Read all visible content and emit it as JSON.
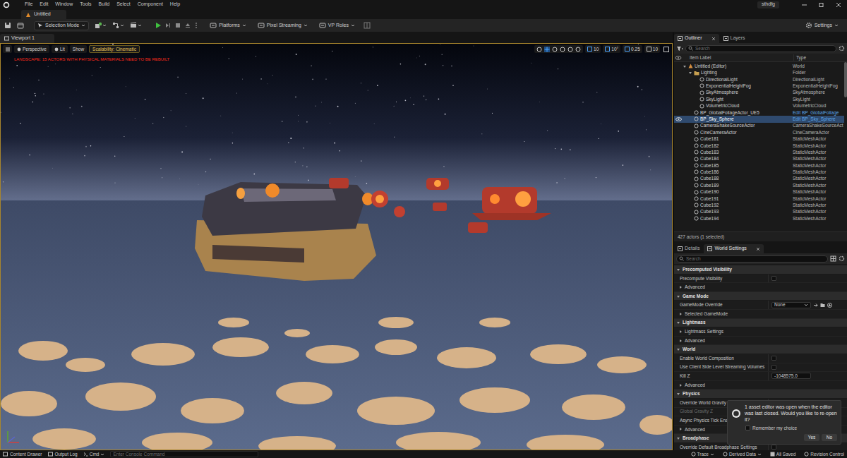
{
  "app": {
    "menu": [
      "File",
      "Edit",
      "Window",
      "Tools",
      "Build",
      "Select",
      "Component",
      "Help"
    ],
    "user": "sthdfg",
    "document_tab": "Untitled"
  },
  "toolbar": {
    "selection_mode": "Selection Mode",
    "items": [
      "Platforms",
      "Pixel Streaming",
      "VP Roles"
    ],
    "settings": "Settings"
  },
  "viewport": {
    "tab": "Viewport 1",
    "view_buttons": [
      "Perspective",
      "Lit",
      "Show",
      "Scalability: Cinematic"
    ],
    "snap_values": [
      "10",
      "10°",
      "0.25",
      "10"
    ],
    "warning": "LANDSCAPE: 15 ACTORS WITH PHYSICAL MATERIALS NEED TO BE REBUILT"
  },
  "outliner": {
    "tabs": [
      {
        "label": "Outliner",
        "selected": true
      },
      {
        "label": "Layers",
        "selected": false
      }
    ],
    "search": {
      "placeholder": "Search"
    },
    "columns": [
      "Item Label",
      "Type"
    ],
    "rows": [
      {
        "label": "Untitled (Editor)",
        "type": "World",
        "kind": "world",
        "depth": 0,
        "expanded": true,
        "selected": false,
        "link": false
      },
      {
        "label": "Lighting",
        "type": "Folder",
        "kind": "folder",
        "depth": 1,
        "expanded": true,
        "selected": false,
        "link": false
      },
      {
        "label": "DirectionalLight",
        "type": "DirectionalLight",
        "kind": "actor",
        "depth": 2,
        "selected": false,
        "link": false
      },
      {
        "label": "ExponentialHeightFog",
        "type": "ExponentialHeightFog",
        "kind": "actor",
        "depth": 2,
        "selected": false,
        "link": false
      },
      {
        "label": "SkyAtmosphere",
        "type": "SkyAtmosphere",
        "kind": "actor",
        "depth": 2,
        "selected": false,
        "link": false
      },
      {
        "label": "SkyLight",
        "type": "SkyLight",
        "kind": "actor",
        "depth": 2,
        "selected": false,
        "link": false
      },
      {
        "label": "VolumetricCloud",
        "type": "VolumetricCloud",
        "kind": "actor",
        "depth": 2,
        "selected": false,
        "link": false
      },
      {
        "label": "BP_GlobalFoliageActor_UE5",
        "type": "Edit BP_GlobalFoliage",
        "kind": "actor",
        "depth": 1,
        "selected": false,
        "link": true
      },
      {
        "label": "BP_Sky_Sphere",
        "type": "Edit BP_Sky_Sphere",
        "kind": "actor",
        "depth": 1,
        "selected": true,
        "link": true
      },
      {
        "label": "CameraShakeSourceActor",
        "type": "CameraShakeSourceAct",
        "kind": "actor",
        "depth": 1,
        "selected": false,
        "link": false
      },
      {
        "label": "CineCameraActor",
        "type": "CineCameraActor",
        "kind": "actor",
        "depth": 1,
        "selected": false,
        "link": false
      },
      {
        "label": "Cube181",
        "type": "StaticMeshActor",
        "kind": "actor",
        "depth": 1,
        "selected": false,
        "link": false
      },
      {
        "label": "Cube182",
        "type": "StaticMeshActor",
        "kind": "actor",
        "depth": 1,
        "selected": false,
        "link": false
      },
      {
        "label": "Cube183",
        "type": "StaticMeshActor",
        "kind": "actor",
        "depth": 1,
        "selected": false,
        "link": false
      },
      {
        "label": "Cube184",
        "type": "StaticMeshActor",
        "kind": "actor",
        "depth": 1,
        "selected": false,
        "link": false
      },
      {
        "label": "Cube185",
        "type": "StaticMeshActor",
        "kind": "actor",
        "depth": 1,
        "selected": false,
        "link": false
      },
      {
        "label": "Cube186",
        "type": "StaticMeshActor",
        "kind": "actor",
        "depth": 1,
        "selected": false,
        "link": false
      },
      {
        "label": "Cube188",
        "type": "StaticMeshActor",
        "kind": "actor",
        "depth": 1,
        "selected": false,
        "link": false
      },
      {
        "label": "Cube189",
        "type": "StaticMeshActor",
        "kind": "actor",
        "depth": 1,
        "selected": false,
        "link": false
      },
      {
        "label": "Cube190",
        "type": "StaticMeshActor",
        "kind": "actor",
        "depth": 1,
        "selected": false,
        "link": false
      },
      {
        "label": "Cube191",
        "type": "StaticMeshActor",
        "kind": "actor",
        "depth": 1,
        "selected": false,
        "link": false
      },
      {
        "label": "Cube192",
        "type": "StaticMeshActor",
        "kind": "actor",
        "depth": 1,
        "selected": false,
        "link": false
      },
      {
        "label": "Cube193",
        "type": "StaticMeshActor",
        "kind": "actor",
        "depth": 1,
        "selected": false,
        "link": false
      },
      {
        "label": "Cube194",
        "type": "StaticMeshActor",
        "kind": "actor",
        "depth": 1,
        "selected": false,
        "link": false
      }
    ],
    "count": "427 actors (1 selected)"
  },
  "details": {
    "tabs": [
      {
        "label": "Details",
        "selected": false
      },
      {
        "label": "World Settings",
        "selected": true
      }
    ],
    "search": {
      "placeholder": "Search"
    },
    "rows": [
      {
        "kind": "section",
        "label": "Precomputed Visibility",
        "expanded": true
      },
      {
        "kind": "checkbox",
        "label": "Precompute Visibility",
        "checked": false,
        "disabled": false
      },
      {
        "kind": "expander",
        "label": "Advanced",
        "expanded": false
      },
      {
        "kind": "section",
        "label": "Game Mode",
        "expanded": true
      },
      {
        "kind": "dropdown",
        "label": "GameMode Override",
        "value": "None",
        "disabled": false
      },
      {
        "kind": "expander",
        "label": "Selected GameMode",
        "expanded": false
      },
      {
        "kind": "section",
        "label": "Lightmass",
        "expanded": true
      },
      {
        "kind": "expander",
        "label": "Lightmass Settings",
        "expanded": false
      },
      {
        "kind": "expander",
        "label": "Advanced",
        "expanded": false
      },
      {
        "kind": "section",
        "label": "World",
        "expanded": true
      },
      {
        "kind": "checkbox",
        "label": "Enable World Composition",
        "checked": false,
        "disabled": false
      },
      {
        "kind": "checkbox",
        "label": "Use Client Side Level Streaming Volumes",
        "checked": false,
        "disabled": false
      },
      {
        "kind": "number",
        "label": "Kill Z",
        "value": "-1048575.0",
        "disabled": false
      },
      {
        "kind": "expander",
        "label": "Advanced",
        "expanded": false
      },
      {
        "kind": "section",
        "label": "Physics",
        "expanded": true
      },
      {
        "kind": "checkbox",
        "label": "Override World Gravity",
        "checked": false,
        "disabled": false
      },
      {
        "kind": "number",
        "label": "Global Gravity Z",
        "disabled": true
      },
      {
        "kind": "checkbox",
        "label": "Async Physics Tick Enab",
        "checked": false,
        "disabled": false
      },
      {
        "kind": "expander",
        "label": "Advanced",
        "expanded": false
      },
      {
        "kind": "section",
        "label": "Broadphase",
        "expanded": true
      },
      {
        "kind": "checkbox",
        "label": "Override Default Broadphase Settings",
        "checked": false,
        "disabled": false
      }
    ]
  },
  "notification": {
    "message": "1 asset editor was open when the editor was last closed. Would you like to re-open it?",
    "remember": {
      "label": "Remember my choice",
      "checked": false
    },
    "buttons": [
      "Yes",
      "No"
    ]
  },
  "status_bar": {
    "left": [
      "Content Drawer",
      "Output Log"
    ],
    "cmd": "Cmd",
    "console": {
      "placeholder": "Enter Console Command"
    },
    "right": [
      "Trace",
      "Derived Data",
      "All Saved",
      "Revision Control"
    ]
  }
}
